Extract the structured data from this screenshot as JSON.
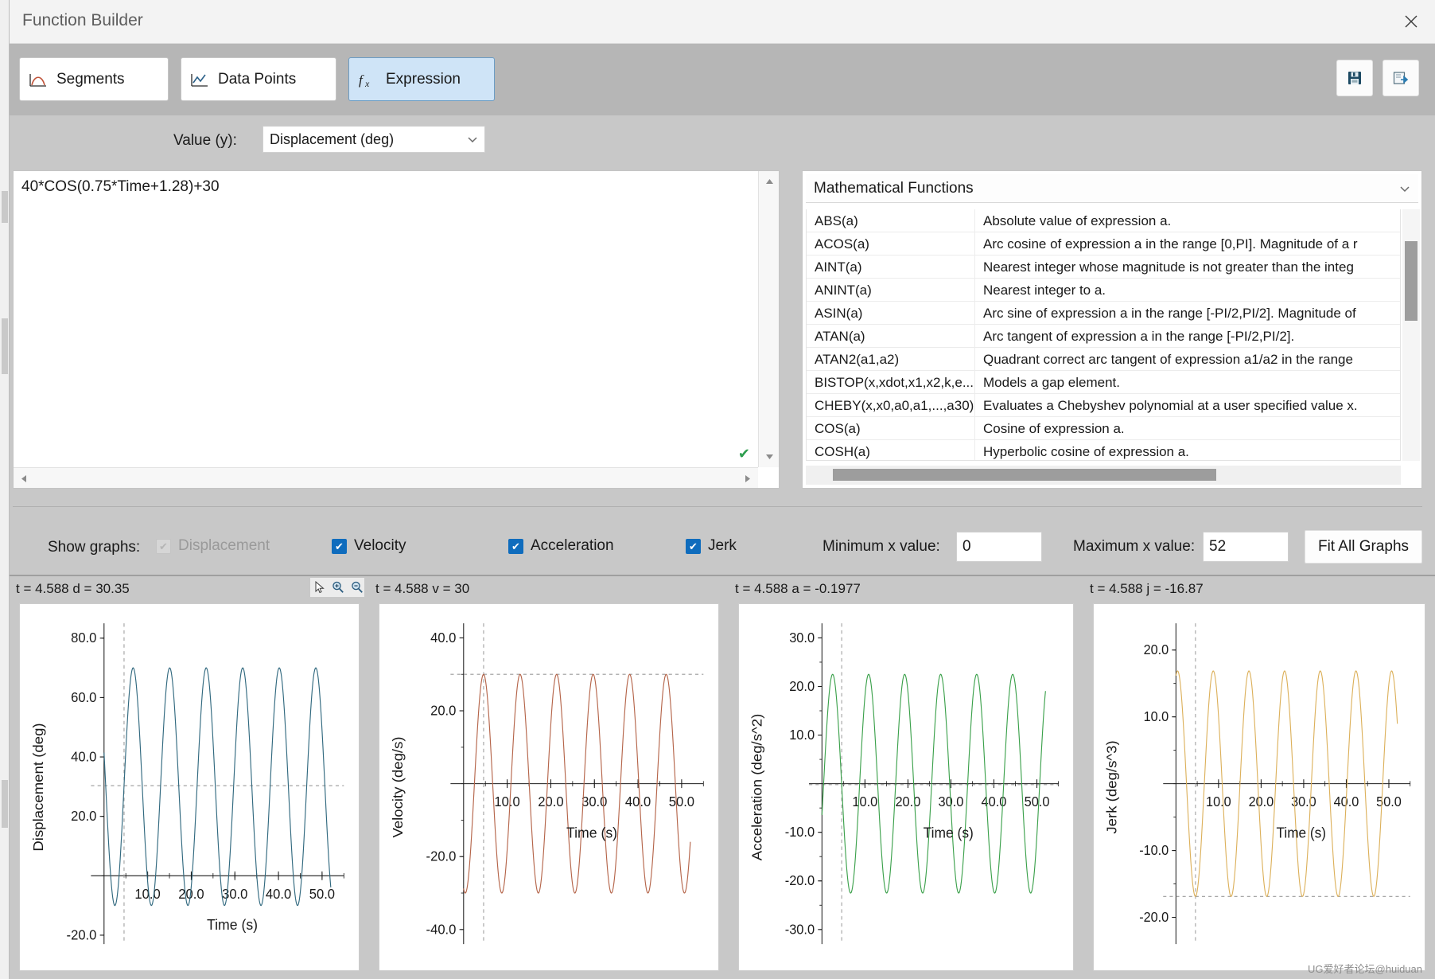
{
  "window": {
    "title": "Function Builder",
    "close_icon": "close-icon"
  },
  "modebar": {
    "buttons": [
      {
        "label": "Segments",
        "icon": "segments-curve-icon",
        "active": false
      },
      {
        "label": "Data Points",
        "icon": "data-points-icon",
        "active": false
      },
      {
        "label": "Expression",
        "icon": "fx-icon",
        "active": true
      }
    ],
    "tools": [
      {
        "icon": "save-icon",
        "name": "save-function-button"
      },
      {
        "icon": "export-icon",
        "name": "export-function-button"
      }
    ]
  },
  "value_row": {
    "label": "Value (y):",
    "selected": "Displacement (deg)",
    "chevron_icon": "chevron-down-icon"
  },
  "expression": {
    "text": "40*COS(0.75*Time+1.28)+30",
    "valid_icon": "check-icon",
    "scroll_up_icon": "triangle-up-icon",
    "scroll_down_icon": "triangle-down-icon",
    "scroll_left_icon": "triangle-left-icon",
    "scroll_right_icon": "triangle-right-icon"
  },
  "function_browser": {
    "category": "Mathematical Functions",
    "chevron_icon": "chevron-down-icon",
    "rows": [
      {
        "name": "ABS(a)",
        "desc": "Absolute value of expression a."
      },
      {
        "name": "ACOS(a)",
        "desc": "Arc cosine of expression a in the range [0,PI]. Magnitude of a r"
      },
      {
        "name": "AINT(a)",
        "desc": "Nearest integer whose magnitude is not greater than the integ"
      },
      {
        "name": "ANINT(a)",
        "desc": "Nearest integer to a."
      },
      {
        "name": "ASIN(a)",
        "desc": "Arc sine of expression a in the range [-PI/2,PI/2]. Magnitude of"
      },
      {
        "name": "ATAN(a)",
        "desc": "Arc tangent of expression a in the range [-PI/2,PI/2]."
      },
      {
        "name": "ATAN2(a1,a2)",
        "desc": "Quadrant correct arc tangent of expression a1/a2 in the range"
      },
      {
        "name": "BISTOP(x,xdot,x1,x2,k,e...",
        "desc": "Models a gap element."
      },
      {
        "name": "CHEBY(x,x0,a0,a1,...,a30)",
        "desc": "Evaluates a Chebyshev polynomial at a user specified value x."
      },
      {
        "name": "COS(a)",
        "desc": "Cosine of expression a."
      },
      {
        "name": "COSH(a)",
        "desc": "Hyperbolic cosine of expression a."
      }
    ]
  },
  "show_graphs": {
    "label": "Show graphs:",
    "checkboxes": [
      {
        "label": "Displacement",
        "checked": true,
        "disabled": true
      },
      {
        "label": "Velocity",
        "checked": true,
        "disabled": false
      },
      {
        "label": "Acceleration",
        "checked": true,
        "disabled": false
      },
      {
        "label": "Jerk",
        "checked": true,
        "disabled": false
      }
    ],
    "min_x_label": "Minimum x value:",
    "min_x_value": "0",
    "max_x_label": "Maximum x value:",
    "max_x_value": "52",
    "fit_all_label": "Fit All Graphs"
  },
  "graph_toolstrip": {
    "icons": [
      "pointer-icon",
      "zoom-in-icon",
      "zoom-out-icon"
    ]
  },
  "watermark": "UG爱好者论坛@huiduan",
  "chart_data": [
    {
      "type": "line",
      "name": "displacement",
      "readout": "t = 4.588  d = 30.35",
      "title": "",
      "xlabel": "Time (s)",
      "ylabel": "Displacement (deg)",
      "xlim": [
        -3,
        55
      ],
      "ylim": [
        -23,
        85
      ],
      "xticks": [
        10.0,
        20.0,
        30.0,
        40.0,
        50.0
      ],
      "xticklabels": [
        "10.0",
        "20.0",
        "30.0",
        "40.0",
        "50.0"
      ],
      "yticks": [
        -20.0,
        20.0,
        40.0,
        60.0,
        80.0
      ],
      "yticklabels": [
        "-20.0",
        "20.0",
        "40.0",
        "60.0",
        "80.0"
      ],
      "color": "#31697f",
      "grid": false,
      "cursor_x": 4.588,
      "marker_y": 30.35,
      "expression": "40*COS(0.75*Time+1.28)+30",
      "amplitude": 40,
      "omega": 0.75,
      "phase": 1.28,
      "offset": 30,
      "x_range": [
        0,
        52
      ]
    },
    {
      "type": "line",
      "name": "velocity",
      "readout": "t = 4.588  v = 30",
      "title": "",
      "xlabel": "Time (s)",
      "ylabel": "Velocity (deg/s)",
      "xlim": [
        -3,
        55
      ],
      "ylim": [
        -44,
        44
      ],
      "xticks": [
        10.0,
        20.0,
        30.0,
        40.0,
        50.0
      ],
      "xticklabels": [
        "10.0",
        "20.0",
        "30.0",
        "40.0",
        "50.0"
      ],
      "yticks": [
        -40.0,
        -20.0,
        20.0,
        40.0
      ],
      "yticklabels": [
        "-40.0",
        "-20.0",
        "20.0",
        "40.0"
      ],
      "color": "#b5654a",
      "grid": false,
      "cursor_x": 4.588,
      "marker_y": 30,
      "amplitude": 30,
      "omega": 0.75,
      "phase": 1.28,
      "offset": 0,
      "derivative": 1,
      "x_range": [
        0,
        52
      ]
    },
    {
      "type": "line",
      "name": "acceleration",
      "readout": "t = 4.588  a = -0.1977",
      "title": "",
      "xlabel": "Time (s)",
      "ylabel": "Acceleration (deg/s^2)",
      "xlim": [
        -3,
        55
      ],
      "ylim": [
        -33,
        33
      ],
      "xticks": [
        10.0,
        20.0,
        30.0,
        40.0,
        50.0
      ],
      "xticklabels": [
        "10.0",
        "20.0",
        "30.0",
        "40.0",
        "50.0"
      ],
      "yticks": [
        -30.0,
        -20.0,
        -10.0,
        10.0,
        20.0,
        30.0
      ],
      "yticklabels": [
        "-30.0",
        "-20.0",
        "-10.0",
        "10.0",
        "20.0",
        "30.0"
      ],
      "color": "#3aa04a",
      "grid": false,
      "cursor_x": 4.588,
      "marker_y": -0.1977,
      "amplitude": 22.5,
      "omega": 0.75,
      "phase": 1.28,
      "offset": 0,
      "derivative": 2,
      "x_range": [
        0,
        52
      ]
    },
    {
      "type": "line",
      "name": "jerk",
      "readout": "t = 4.588  j = -16.87",
      "title": "",
      "xlabel": "Time (s)",
      "ylabel": "Jerk (deg/s^3)",
      "xlim": [
        -3,
        55
      ],
      "ylim": [
        -24,
        24
      ],
      "xticks": [
        10.0,
        20.0,
        30.0,
        40.0,
        50.0
      ],
      "xticklabels": [
        "10.0",
        "20.0",
        "30.0",
        "40.0",
        "50.0"
      ],
      "yticks": [
        -20.0,
        -10.0,
        10.0,
        20.0
      ],
      "yticklabels": [
        "-20.0",
        "-10.0",
        "10.0",
        "20.0"
      ],
      "color": "#dcb05a",
      "grid": false,
      "cursor_x": 4.588,
      "marker_y": -16.87,
      "amplitude": 16.87,
      "omega": 0.75,
      "phase": 1.28,
      "offset": 0,
      "derivative": 3,
      "x_range": [
        0,
        52
      ]
    }
  ]
}
